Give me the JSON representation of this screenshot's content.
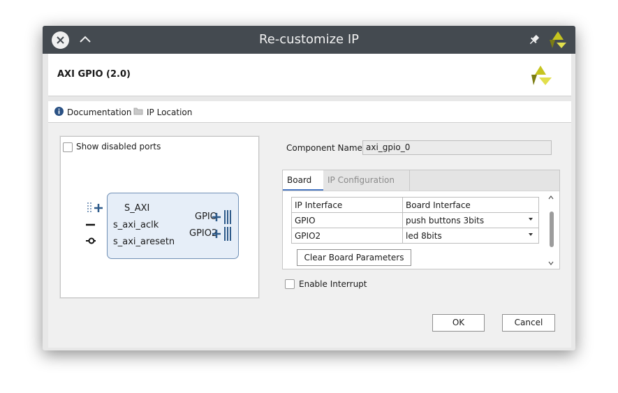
{
  "window": {
    "title": "Re-customize IP",
    "controls": [
      "close-icon",
      "chevron-up-icon",
      "pin-icon"
    ]
  },
  "header": {
    "ip_name": "AXI GPIO (2.0)"
  },
  "links": {
    "documentation": "Documentation",
    "ip_location": "IP Location"
  },
  "symbol_panel": {
    "show_disabled_ports": {
      "label": "Show disabled ports",
      "checked": false
    },
    "block": {
      "left_ports": [
        "S_AXI",
        "s_axi_aclk",
        "s_axi_aresetn"
      ],
      "right_ports": [
        "GPIO",
        "GPIO2"
      ]
    }
  },
  "config": {
    "component_name_label": "Component Name",
    "component_name_value": "axi_gpio_0",
    "tabs": [
      {
        "label": "Board",
        "active": true
      },
      {
        "label": "IP Configuration",
        "active": false
      }
    ],
    "board_table": {
      "headers": [
        "IP Interface",
        "Board Interface"
      ],
      "rows": [
        {
          "ip_interface": "GPIO",
          "board_interface": "push buttons 3bits"
        },
        {
          "ip_interface": "GPIO2",
          "board_interface": "led 8bits"
        }
      ]
    },
    "clear_button": "Clear Board Parameters",
    "enable_interrupt": {
      "label": "Enable Interrupt",
      "checked": false
    }
  },
  "footer": {
    "ok": "OK",
    "cancel": "Cancel"
  },
  "colors": {
    "titlebar": "#444a50",
    "brand": "#c6c41f",
    "brand_dark": "#7c7d14",
    "port_blue": "#2e5b8a"
  }
}
